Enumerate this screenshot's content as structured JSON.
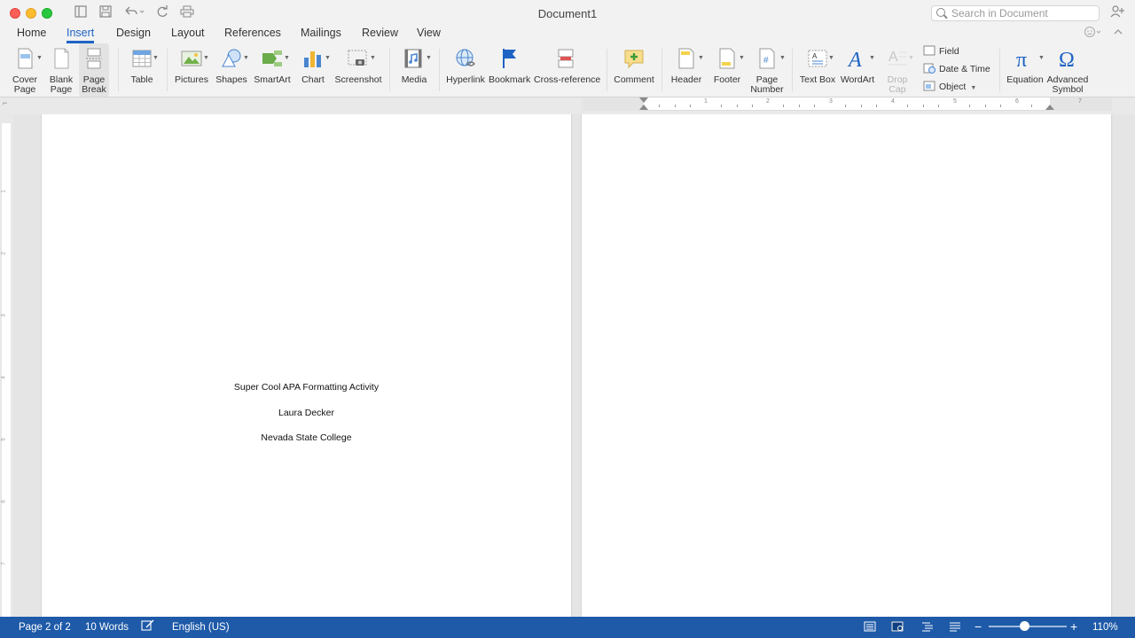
{
  "window": {
    "title": "Document1"
  },
  "search": {
    "placeholder": "Search in Document"
  },
  "tabs": [
    {
      "label": "Home"
    },
    {
      "label": "Insert"
    },
    {
      "label": "Design"
    },
    {
      "label": "Layout"
    },
    {
      "label": "References"
    },
    {
      "label": "Mailings"
    },
    {
      "label": "Review"
    },
    {
      "label": "View"
    }
  ],
  "ribbon": {
    "cover_page": "Cover\nPage",
    "blank_page": "Blank\nPage",
    "page_break": "Page\nBreak",
    "table": "Table",
    "pictures": "Pictures",
    "shapes": "Shapes",
    "smartart": "SmartArt",
    "chart": "Chart",
    "screenshot": "Screenshot",
    "media": "Media",
    "hyperlink": "Hyperlink",
    "bookmark": "Bookmark",
    "cross_reference": "Cross-reference",
    "comment": "Comment",
    "header": "Header",
    "footer": "Footer",
    "page_number": "Page\nNumber",
    "text_box": "Text Box",
    "wordart": "WordArt",
    "drop_cap": "Drop\nCap",
    "field": "Field",
    "date_time": "Date & Time",
    "object": "Object",
    "equation": "Equation",
    "advanced_symbol": "Advanced\nSymbol"
  },
  "ruler": {
    "numbers": [
      "1",
      "2",
      "3",
      "4",
      "5",
      "6",
      "7"
    ]
  },
  "vruler": {
    "numbers": [
      "1",
      "2",
      "3",
      "4",
      "5",
      "6",
      "7"
    ]
  },
  "document": {
    "title_line": "Super Cool APA Formatting Activity",
    "author_line": "Laura Decker",
    "institution_line": "Nevada State College"
  },
  "status": {
    "page": "Page 2 of 2",
    "words": "10 Words",
    "language": "English (US)",
    "zoom": "110%",
    "zoom_level_fraction": 0.46
  },
  "colors": {
    "accent": "#1f63c4",
    "status_bar": "#1e5aa8"
  }
}
